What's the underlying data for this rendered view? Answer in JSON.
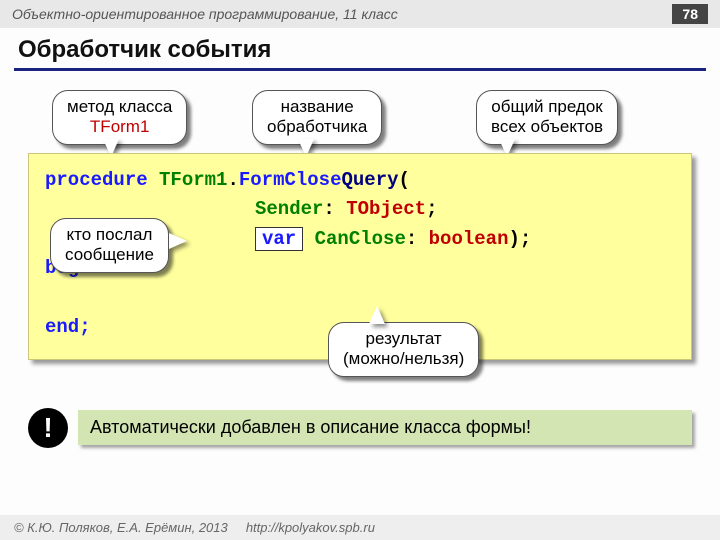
{
  "header": {
    "course": "Объектно-ориентированное программирование, 11 класс",
    "page": "78"
  },
  "title": "Обработчик события",
  "callouts": {
    "method": {
      "line1": "метод класса",
      "line2": "TForm1"
    },
    "name": {
      "line1": "название",
      "line2": "обработчика"
    },
    "ancestor": {
      "line1": "общий предок",
      "line2": "всех объектов"
    },
    "sender": {
      "line1": "кто послал",
      "line2": "сообщение"
    },
    "result": {
      "line1": "результат",
      "line2": "(можно/нельзя)"
    }
  },
  "code": {
    "kw_proc": "procedure",
    "cls": "TForm1",
    "dot": ".",
    "meth": "FormClose",
    "meth2": "Query",
    "lpar": "(",
    "sender": "Sender",
    "colon": ":",
    "tobj": "TObject",
    "semi": ";",
    "var": "var",
    "canclose": "CanClose",
    "bool": "boolean",
    "rpar": ");",
    "begin": "begin",
    "end": "end;"
  },
  "alert": "Автоматически добавлен в описание класса формы!",
  "footer": {
    "copy": "© К.Ю. Поляков, Е.А. Ерёмин, 2013",
    "url": "http://kpolyakov.spb.ru"
  }
}
